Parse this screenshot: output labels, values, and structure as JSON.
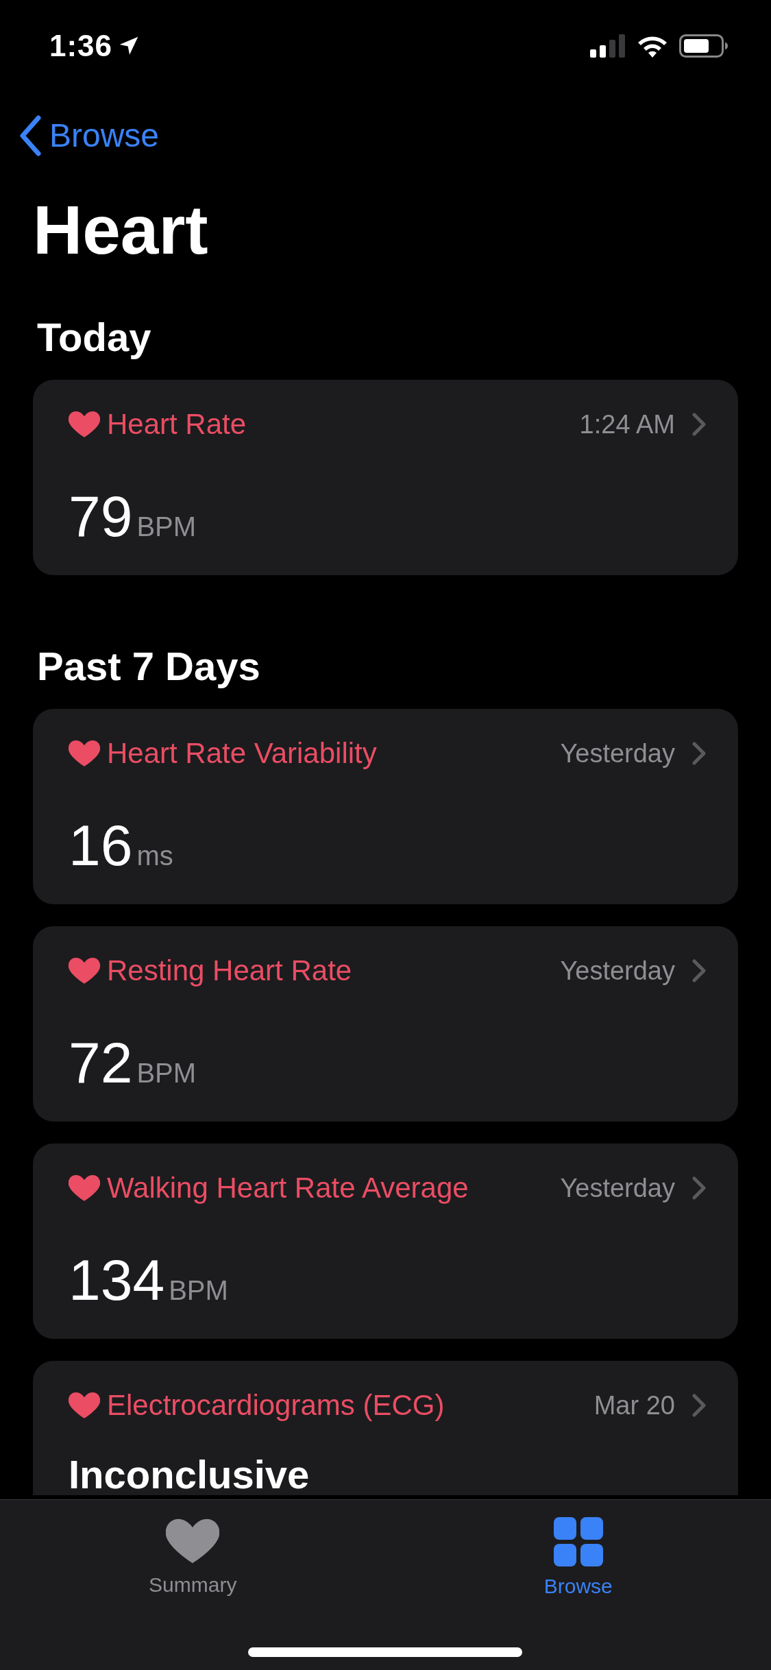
{
  "status_bar": {
    "time": "1:36"
  },
  "nav": {
    "back_label": "Browse"
  },
  "title": "Heart",
  "sections": [
    {
      "title": "Today",
      "cards": [
        {
          "kind": "measurement",
          "title": "Heart Rate",
          "time": "1:24 AM",
          "value": "79",
          "unit": "BPM"
        }
      ]
    },
    {
      "title": "Past 7 Days",
      "cards": [
        {
          "kind": "measurement",
          "title": "Heart Rate Variability",
          "time": "Yesterday",
          "value": "16",
          "unit": "ms"
        },
        {
          "kind": "measurement",
          "title": "Resting Heart Rate",
          "time": "Yesterday",
          "value": "72",
          "unit": "BPM"
        },
        {
          "kind": "measurement",
          "title": "Walking Heart Rate Average",
          "time": "Yesterday",
          "value": "134",
          "unit": "BPM"
        },
        {
          "kind": "text",
          "title": "Electrocardiograms (ECG)",
          "time": "Mar 20",
          "value": "Inconclusive"
        }
      ]
    }
  ],
  "tab_bar": {
    "tabs": [
      {
        "label": "Summary",
        "selected": false
      },
      {
        "label": "Browse",
        "selected": true
      }
    ]
  }
}
